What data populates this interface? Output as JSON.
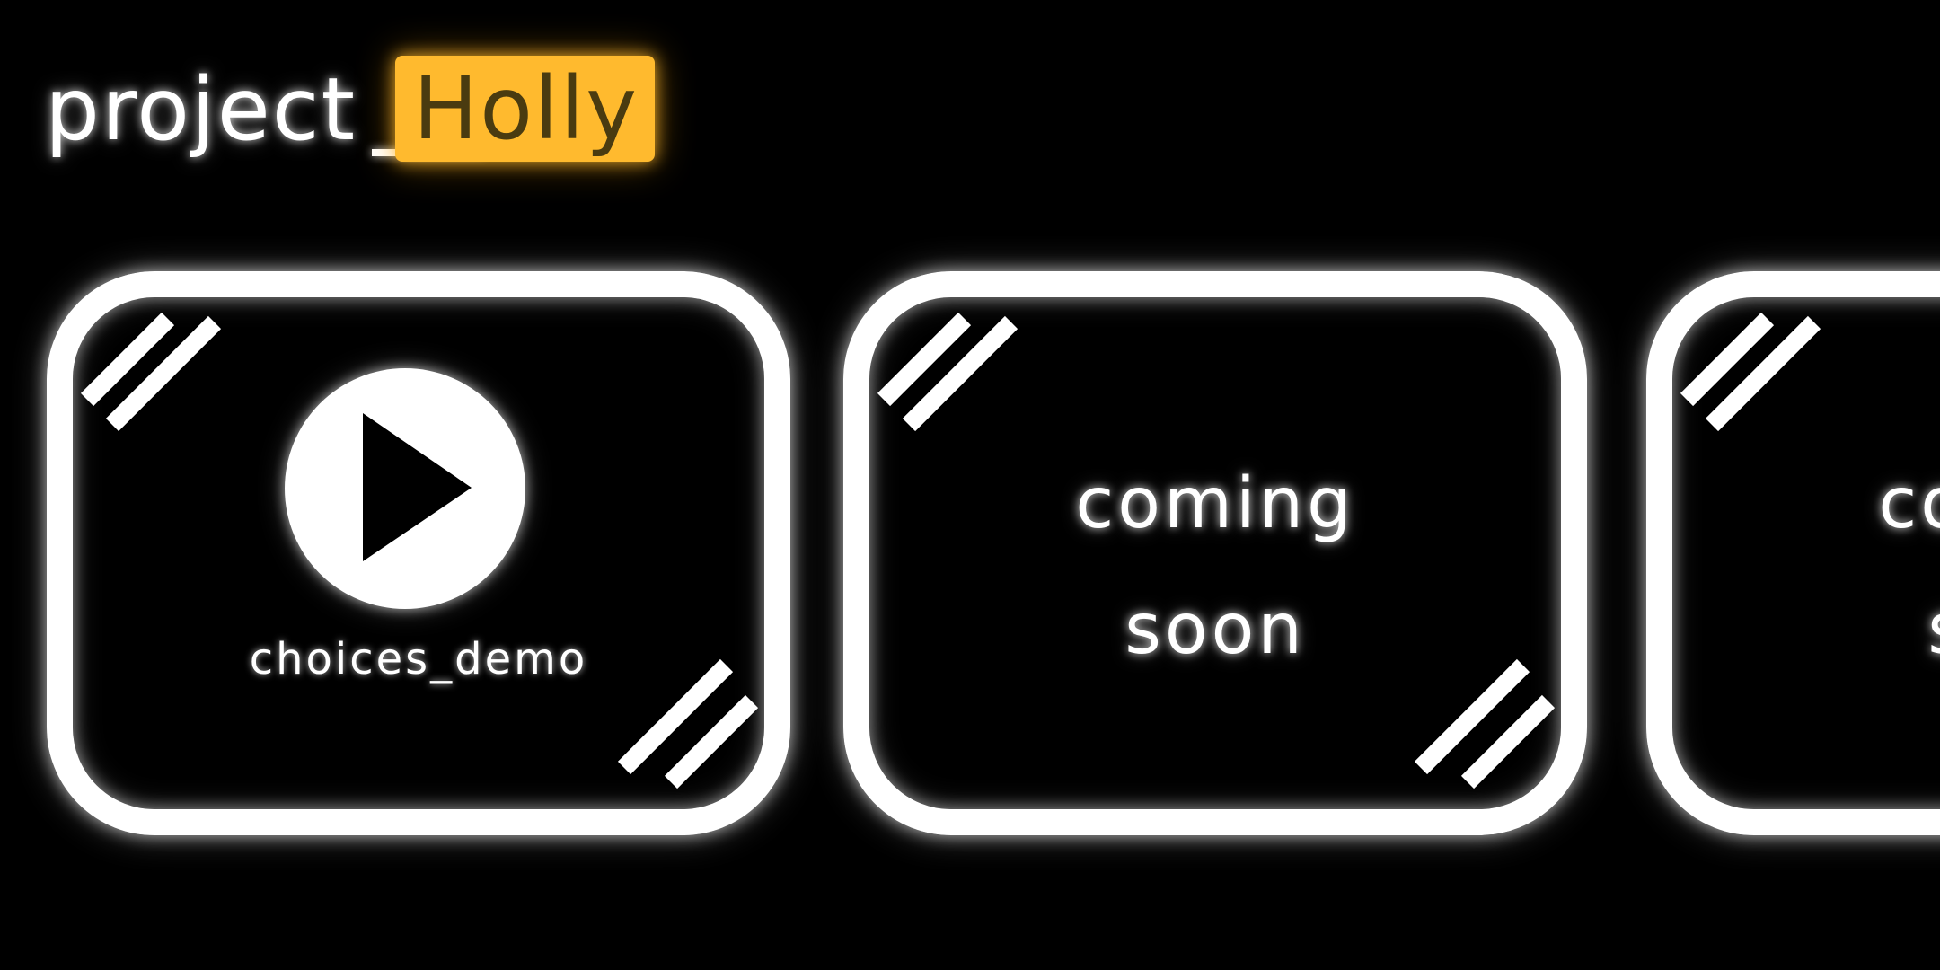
{
  "logo": {
    "prefix": "project",
    "highlight": "Holly",
    "highlight_color": "#FFBA2E"
  },
  "cards": [
    {
      "icon": "play-icon",
      "label": "choices_demo"
    },
    {
      "line1": "coming",
      "line2": "soon"
    },
    {
      "line1": "coming",
      "line2": "soon"
    }
  ],
  "colors": {
    "background": "#000000",
    "outline": "#FFFFFF"
  }
}
